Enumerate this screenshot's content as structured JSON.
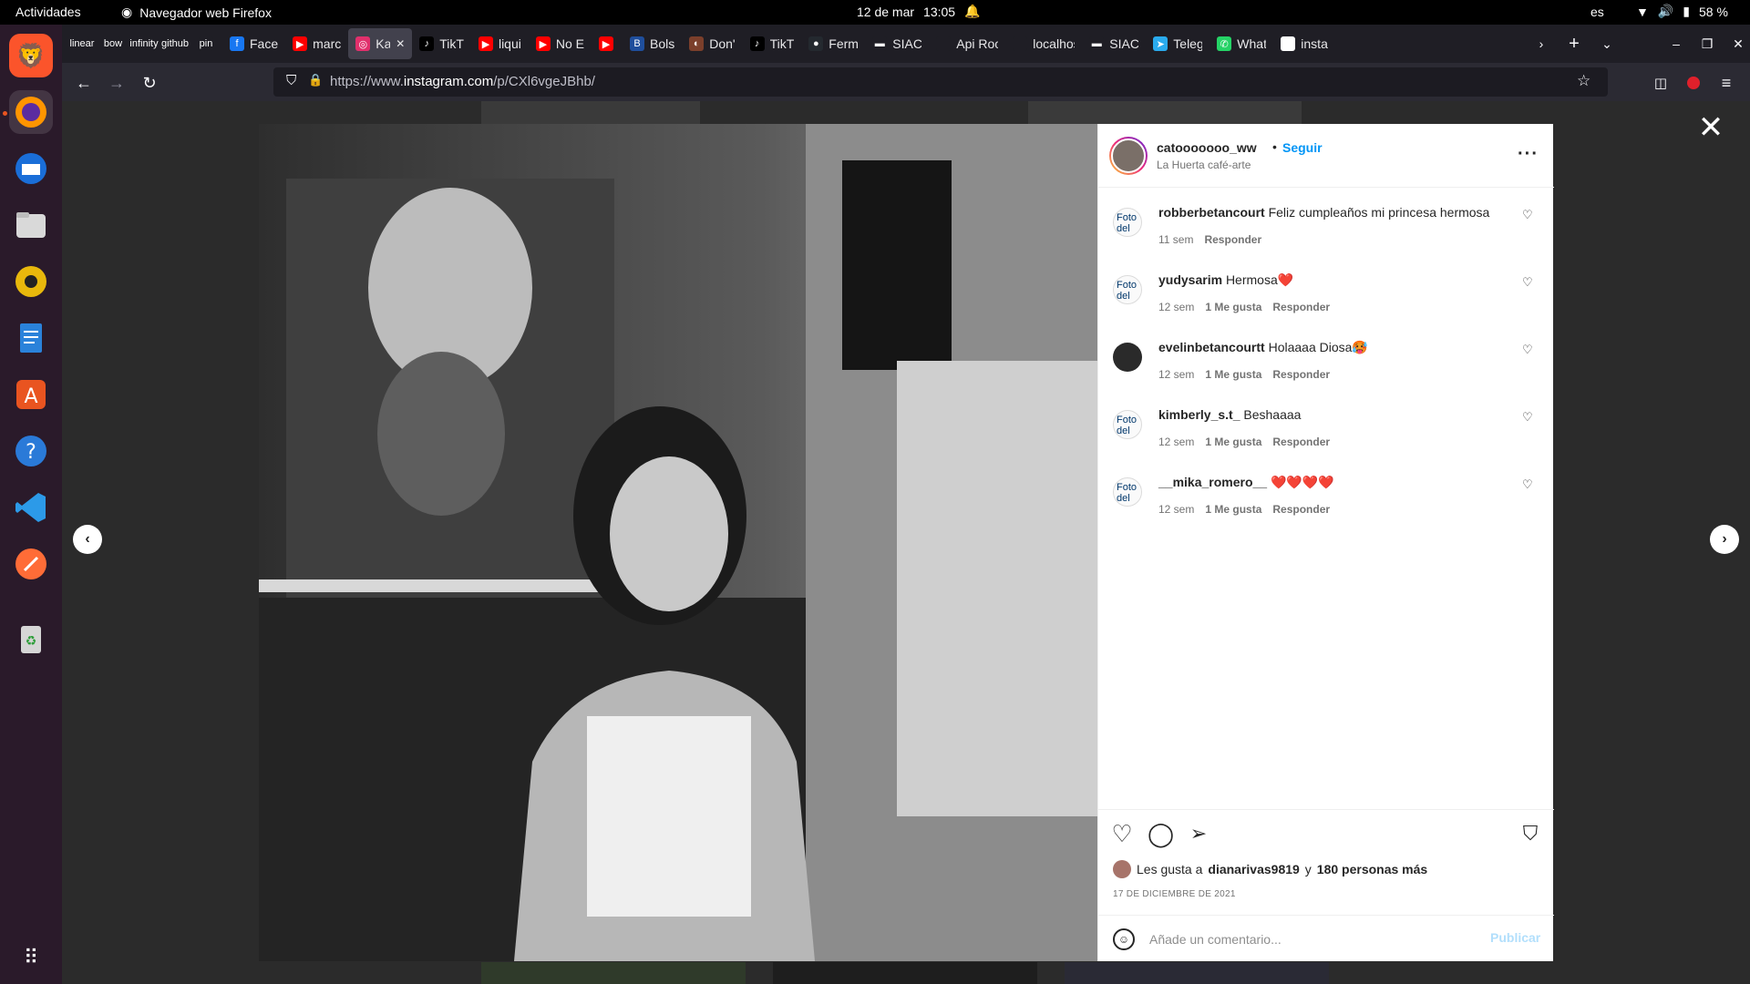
{
  "topbar": {
    "activities": "Actividades",
    "app_name": "Navegador web Firefox",
    "date": "12 de mar",
    "time": "13:05",
    "lang": "es",
    "battery": "58 %"
  },
  "dock": {
    "items": [
      "brave-browser",
      "firefox",
      "thunderbird",
      "files",
      "rhythmbox",
      "libreoffice-writer",
      "software-center",
      "help",
      "vscode",
      "postman",
      "trash",
      "show-apps"
    ]
  },
  "tabs": [
    {
      "label": "",
      "icon": "linear",
      "color": "#1f1e25"
    },
    {
      "label": "",
      "icon": "bow",
      "color": "#1f1e25"
    },
    {
      "label": "",
      "icon": "infinity",
      "color": "#1f1e25"
    },
    {
      "label": "",
      "icon": "github",
      "color": "#1f1e25"
    },
    {
      "label": "",
      "icon": "pin",
      "color": "#1f1e25"
    },
    {
      "label": "Face",
      "icon": "f",
      "color": "#1877f2"
    },
    {
      "label": "marc",
      "icon": "▶",
      "color": "#ff0000"
    },
    {
      "label": "Ka",
      "icon": "◎",
      "color": "#e1306c"
    },
    {
      "label": "TikT",
      "icon": "♪",
      "color": "#000000"
    },
    {
      "label": "liqui",
      "icon": "▶",
      "color": "#ff0000"
    },
    {
      "label": "No E",
      "icon": "▶",
      "color": "#ff0000"
    },
    {
      "label": "",
      "icon": "▶",
      "color": "#ff0000"
    },
    {
      "label": "Bols",
      "icon": "B",
      "color": "#1f4e9c"
    },
    {
      "label": "Don'",
      "icon": "◐",
      "color": "#7b3f2b"
    },
    {
      "label": "TikT",
      "icon": "♪",
      "color": "#000000"
    },
    {
      "label": "Ferm",
      "icon": "●",
      "color": "#24292f"
    },
    {
      "label": "SIAC",
      "icon": "▬",
      "color": "#1f1e25"
    },
    {
      "label": "Api Root",
      "icon": "",
      "color": "#1f1e25"
    },
    {
      "label": "localhos",
      "icon": "",
      "color": "#1f1e25"
    },
    {
      "label": "SIAC",
      "icon": "▬",
      "color": "#1f1e25"
    },
    {
      "label": "Teleg",
      "icon": "➤",
      "color": "#2aabee"
    },
    {
      "label": "What",
      "icon": "✆",
      "color": "#25d366"
    },
    {
      "label": "insta",
      "icon": "G",
      "color": "#ffffff"
    }
  ],
  "urlbar": {
    "prefix": "https://www.",
    "host": "instagram.com",
    "path": "/p/CXl6vgeJBhb/"
  },
  "post": {
    "username": "catooooooo_ww",
    "dot": "•",
    "follow": "Seguir",
    "location": "La Huerta café-arte",
    "more": "···",
    "comments": [
      {
        "user": "robberbetancourt",
        "text": "Feliz cumpleaños mi princesa hermosa",
        "time": "11 sem",
        "likes": "",
        "reply": "Responder",
        "avatar": "Foto del"
      },
      {
        "user": "yudysarim",
        "text": "Hermosa❤️",
        "time": "12 sem",
        "likes": "1 Me gusta",
        "reply": "Responder",
        "avatar": "Foto del"
      },
      {
        "user": "evelinbetancourtt",
        "text": "Holaaaa Diosa🥵",
        "time": "12 sem",
        "likes": "1 Me gusta",
        "reply": "Responder",
        "avatar": ""
      },
      {
        "user": "kimberly_s.t_",
        "text": "Beshaaaa",
        "time": "12 sem",
        "likes": "1 Me gusta",
        "reply": "Responder",
        "avatar": "Foto del"
      },
      {
        "user": "__mika_romero__",
        "text": "❤️❤️❤️❤️",
        "time": "12 sem",
        "likes": "1 Me gusta",
        "reply": "Responder",
        "avatar": "Foto del"
      }
    ],
    "likes_prefix": "Les gusta a",
    "likes_user": "dianarivas9819",
    "likes_and": "y",
    "likes_others": "180 personas más",
    "date": "17 DE DICIEMBRE DE 2021",
    "comment_placeholder": "Añade un comentario...",
    "publish": "Publicar"
  }
}
